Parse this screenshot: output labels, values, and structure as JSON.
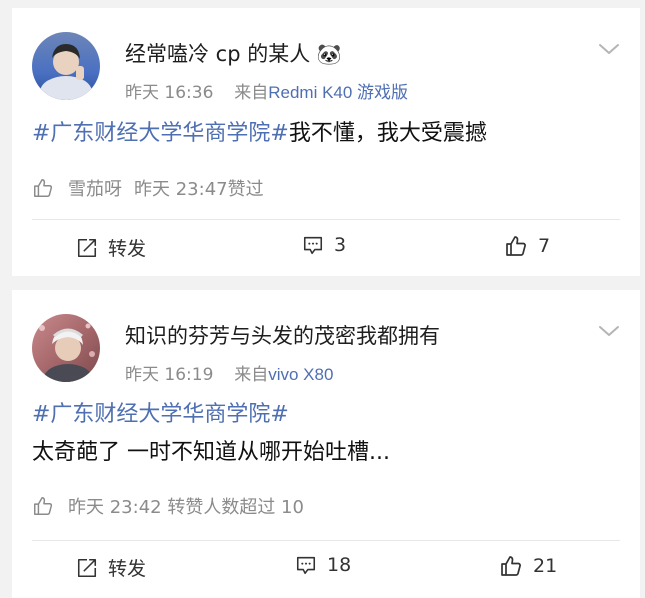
{
  "posts": [
    {
      "username": "经常嗑冷 cp 的某人",
      "username_emoji": "🐼",
      "time": "昨天 16:36",
      "source_prefix": "来自",
      "source_device": "Redmi K40 游戏版",
      "topic": "#广东财经大学华商学院#",
      "text": "我不懂，我大受震撼",
      "like_user": "雪茄呀",
      "like_time": "昨天 23:47",
      "like_suffix": "赞过",
      "repost_label": "转发",
      "comment_count": "3",
      "like_count": "7"
    },
    {
      "username": "知识的芬芳与头发的茂密我都拥有",
      "time": "昨天 16:19",
      "source_prefix": "来自",
      "source_device": "vivo X80",
      "topic": "#广东财经大学华商学院#",
      "text": "太奇葩了 一时不知道从哪开始吐槽...",
      "like_summary": "昨天 23:42 转赞人数超过 10",
      "repost_label": "转发",
      "comment_count": "18",
      "like_count": "21"
    }
  ],
  "colors": {
    "topic_link": "#4f6fb3",
    "source_link": "#4f6fb3",
    "meta_gray": "#8b8b8b",
    "page_background": "#f2f2f2"
  },
  "icons": {
    "more": "chevron-down-icon",
    "repost": "repost-icon",
    "comment": "comment-icon",
    "like": "thumbs-up-icon"
  }
}
